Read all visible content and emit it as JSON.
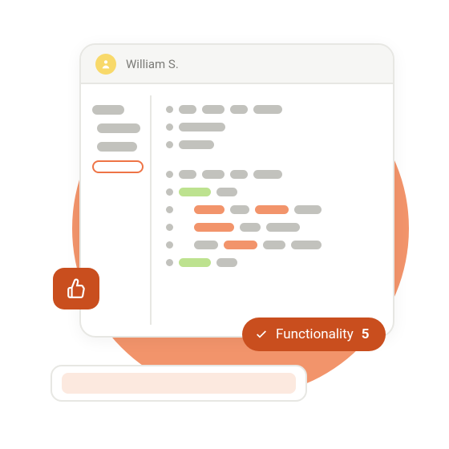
{
  "user": {
    "name": "William S."
  },
  "badge": {
    "label": "Functionality",
    "score": "5"
  },
  "colors": {
    "accent": "#c94e1e",
    "circle": "#f2946b",
    "green": "#bde28f",
    "gray": "#c2c2bd"
  },
  "icons": {
    "avatar": "user-avatar-icon",
    "like": "thumbs-up-icon",
    "check": "check-icon"
  }
}
